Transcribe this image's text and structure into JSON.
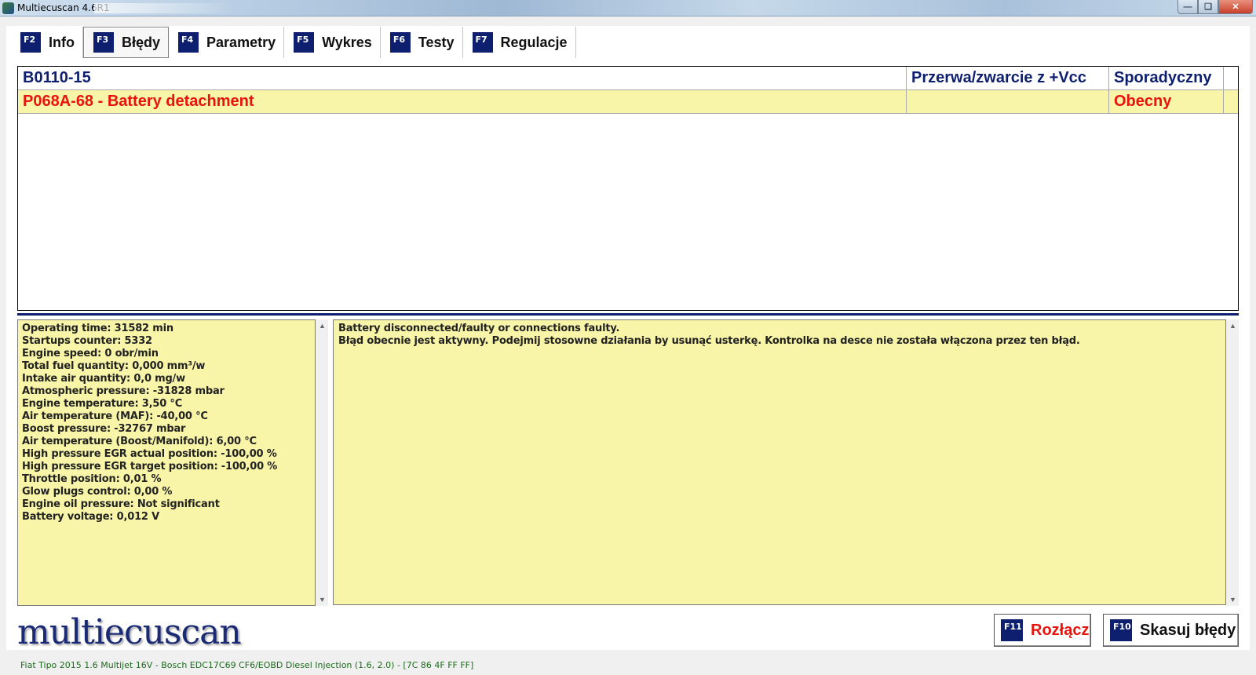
{
  "window": {
    "title": "Multiecuscan 4.6R1"
  },
  "tabs": [
    {
      "key": "F2",
      "label": "Info"
    },
    {
      "key": "F3",
      "label": "Błędy"
    },
    {
      "key": "F4",
      "label": "Parametry"
    },
    {
      "key": "F5",
      "label": "Wykres"
    },
    {
      "key": "F6",
      "label": "Testy"
    },
    {
      "key": "F7",
      "label": "Regulacje"
    }
  ],
  "active_tab": "Błędy",
  "dtc_list": [
    {
      "code": "B0110-15",
      "description": "Przerwa/zwarcie z +Vcc",
      "status": "Sporadyczny",
      "color": "#0d1f6e"
    },
    {
      "code": "P068A-68 - Battery detachment",
      "description": "",
      "status": "Obecny",
      "color": "#e8140c"
    }
  ],
  "freeze_frame": [
    "Operating time: 31582 min",
    "Startups counter: 5332",
    "Engine speed: 0 obr/min",
    "Total fuel quantity: 0,000 mm³/w",
    "Intake air quantity: 0,0 mg/w",
    "Atmospheric pressure: -31828 mbar",
    "Engine temperature: 3,50 °C",
    "Air temperature (MAF): -40,00 °C",
    "Boost pressure: -32767 mbar",
    "Air temperature (Boost/Manifold): 6,00 °C",
    "High pressure EGR actual position: -100,00 %",
    "High pressure EGR target position: -100,00 %",
    "Throttle position: 0,01 %",
    "Glow plugs control: 0,00 %",
    "Engine oil pressure: Not significant",
    "Battery voltage: 0,012 V"
  ],
  "description": [
    "Battery disconnected/faulty or connections faulty.",
    "Błąd obecnie jest aktywny. Podejmij stosowne działania by usunąć usterkę. Kontrolka na desce nie została włączona przez ten błąd."
  ],
  "logo_text": "multiecuscan",
  "buttons": {
    "disconnect": {
      "key": "F11",
      "label": "Rozłącz",
      "color": "#e8140c"
    },
    "clear": {
      "key": "F10",
      "label": "Skasuj błędy",
      "color": "#111111"
    }
  },
  "status_bar": "Fiat Tipo 2015 1.6 Multijet 16V - Bosch EDC17C69 CF6/EOBD Diesel Injection (1.6, 2.0) - [7C 86 4F FF FF]",
  "colors": {
    "accent": "#0d1f6e",
    "panel_yellow": "#f8f5a8",
    "error_red": "#e8140c"
  }
}
